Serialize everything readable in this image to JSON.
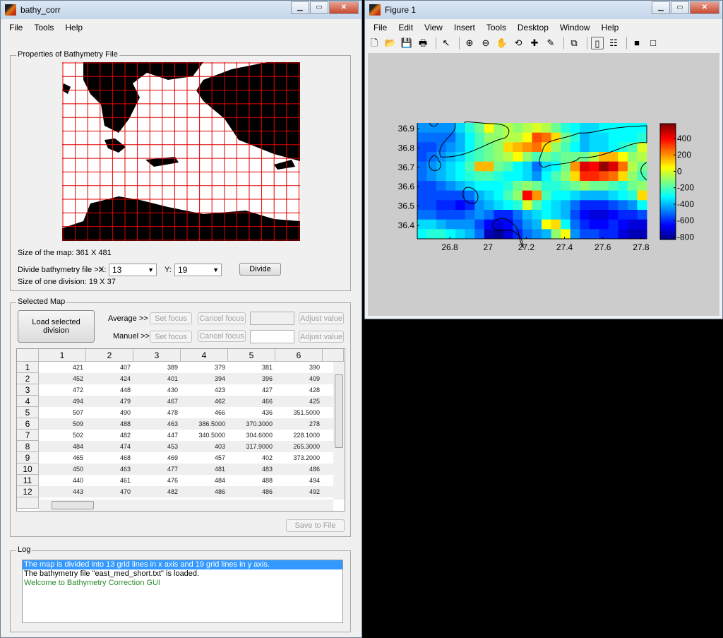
{
  "left_window": {
    "title": "bathy_corr",
    "menu": [
      "File",
      "Tools",
      "Help"
    ],
    "properties": {
      "legend": "Properties of Bathymetry File",
      "map_size": "Size of the map: 361 X 481",
      "divide_label": "Divide bathymetry file >>",
      "x_label": "X:",
      "x_value": "13",
      "y_label": "Y:",
      "y_value": "19",
      "divide_button": "Divide",
      "division_size": "Size of one division: 19 X 37"
    },
    "selected_map": {
      "legend": "Selected Map",
      "load_button": "Load selected division",
      "average_label": "Average >>",
      "manuel_label": "Manuel >>",
      "set_focus": "Set focus",
      "cancel_focus": "Cancel focus",
      "adjust_value": "Adjust value",
      "save_button": "Save to File",
      "table": {
        "columns": [
          "1",
          "2",
          "3",
          "4",
          "5",
          "6"
        ],
        "rows": [
          [
            "421",
            "407",
            "389",
            "379",
            "381",
            "390"
          ],
          [
            "452",
            "424",
            "401",
            "394",
            "396",
            "409"
          ],
          [
            "472",
            "448",
            "430",
            "423",
            "427",
            "428"
          ],
          [
            "494",
            "479",
            "467",
            "462",
            "466",
            "425"
          ],
          [
            "507",
            "490",
            "478",
            "466",
            "436",
            "351.5000"
          ],
          [
            "509",
            "488",
            "463",
            "386.5000",
            "370.3000",
            "278"
          ],
          [
            "502",
            "482",
            "447",
            "340.5000",
            "304.6000",
            "228.1000"
          ],
          [
            "484",
            "474",
            "453",
            "403",
            "317.9000",
            "265.3000"
          ],
          [
            "465",
            "468",
            "469",
            "457",
            "402",
            "373.2000"
          ],
          [
            "450",
            "463",
            "477",
            "481",
            "483",
            "486"
          ],
          [
            "440",
            "461",
            "476",
            "484",
            "488",
            "494"
          ],
          [
            "443",
            "470",
            "482",
            "486",
            "486",
            "492"
          ]
        ]
      }
    },
    "log": {
      "legend": "Log",
      "entries": [
        {
          "text": "The map is divided into 13 grid lines in x axis and 19 grid lines in y axis.",
          "color": "#ffffff",
          "selected": true
        },
        {
          "text": "The bathymetry file \"east_med_short.txt\" is loaded.",
          "color": "#000000"
        },
        {
          "text": "Welcome to Bathymetry Correction GUI",
          "color": "#2a8a2a"
        }
      ]
    }
  },
  "figure_window": {
    "title": "Figure 1",
    "menu": [
      "File",
      "Edit",
      "View",
      "Insert",
      "Tools",
      "Desktop",
      "Window",
      "Help"
    ],
    "toolbar": [
      "new-file-icon",
      "open-icon",
      "save-icon",
      "print-icon",
      "pointer-icon",
      "zoom-in-icon",
      "zoom-out-icon",
      "pan-icon",
      "rotate-icon",
      "data-cursor-icon",
      "brush-icon",
      "link-icon",
      "colorbar-icon",
      "legend-icon",
      "hide-tools-icon",
      "dock-icon"
    ]
  },
  "chart_data": {
    "type": "heatmap",
    "colormap": "jet",
    "x_ticks": [
      26.8,
      27,
      27.2,
      27.4,
      27.6,
      27.8
    ],
    "y_ticks": [
      36.4,
      36.5,
      36.6,
      36.7,
      36.8,
      36.9
    ],
    "xlim": [
      26.63,
      27.83
    ],
    "ylim": [
      36.33,
      36.93
    ],
    "colorbar_ticks": [
      400,
      200,
      0,
      -200,
      -400,
      -600,
      -800
    ],
    "clim": [
      -830,
      580
    ],
    "contour_level": 0,
    "values": [
      [
        -450,
        -450,
        -450,
        -450,
        -350,
        -250,
        -150,
        50,
        -100,
        -50,
        -100,
        -50,
        0,
        -50,
        -150,
        -250,
        -300,
        -350,
        -350,
        -300,
        -300,
        -300,
        -300,
        -300
      ],
      [
        -500,
        -500,
        -500,
        -500,
        -400,
        -300,
        -200,
        -100,
        -100,
        -50,
        -50,
        50,
        300,
        250,
        100,
        -150,
        -250,
        -400,
        -350,
        -350,
        -300,
        -300,
        -300,
        -250
      ],
      [
        -550,
        -550,
        -500,
        -450,
        -400,
        -300,
        -200,
        -150,
        -100,
        100,
        150,
        200,
        250,
        100,
        -100,
        -200,
        -300,
        -400,
        -350,
        -350,
        -300,
        -250,
        -200,
        0
      ],
      [
        -550,
        -500,
        -450,
        -400,
        -350,
        -250,
        -200,
        -150,
        -100,
        -50,
        50,
        -100,
        -200,
        -150,
        -200,
        -150,
        -150,
        -150,
        -50,
        150,
        150,
        50,
        -100,
        -50
      ],
      [
        -500,
        -450,
        -400,
        -350,
        -300,
        -200,
        150,
        150,
        -150,
        -200,
        -300,
        -350,
        -500,
        -350,
        -300,
        -150,
        200,
        450,
        400,
        550,
        450,
        250,
        -50,
        -150
      ],
      [
        -500,
        -450,
        -400,
        -350,
        -300,
        -250,
        -200,
        -200,
        -250,
        -300,
        -300,
        -350,
        -450,
        -300,
        -200,
        -100,
        100,
        350,
        350,
        300,
        250,
        100,
        -100,
        -200
      ],
      [
        -550,
        -550,
        -500,
        -450,
        -400,
        -350,
        -300,
        -300,
        -300,
        -250,
        -150,
        -100,
        -150,
        -250,
        -250,
        -200,
        -150,
        -100,
        -150,
        -150,
        -200,
        -250,
        -150,
        -100
      ],
      [
        -550,
        -550,
        -550,
        -550,
        -550,
        -500,
        -400,
        -350,
        -300,
        -200,
        -100,
        400,
        200,
        -200,
        -300,
        -300,
        -350,
        -400,
        -400,
        -400,
        -350,
        -300,
        -250,
        100
      ],
      [
        -550,
        -550,
        -600,
        -600,
        -650,
        -600,
        -450,
        -400,
        -350,
        -300,
        -250,
        0,
        -200,
        -300,
        -350,
        -400,
        -500,
        -600,
        -600,
        -600,
        -550,
        -500,
        -450,
        -300
      ],
      [
        -500,
        -500,
        -550,
        -550,
        -550,
        -500,
        -450,
        -500,
        -600,
        -600,
        -500,
        -400,
        -350,
        -300,
        -350,
        -400,
        -550,
        -650,
        -700,
        -700,
        -650,
        -600,
        -600,
        -550
      ],
      [
        -350,
        -350,
        -400,
        -450,
        -450,
        -450,
        -550,
        -650,
        -700,
        -650,
        -550,
        -450,
        -400,
        50,
        100,
        -300,
        -500,
        -600,
        -650,
        -650,
        -600,
        -650,
        -700,
        -700
      ],
      [
        -300,
        -250,
        -250,
        -300,
        -350,
        -400,
        -500,
        -750,
        -800,
        -700,
        -600,
        -500,
        -450,
        -400,
        -100,
        50,
        -450,
        -550,
        -550,
        -600,
        -600,
        -700,
        -750,
        -750
      ]
    ]
  }
}
